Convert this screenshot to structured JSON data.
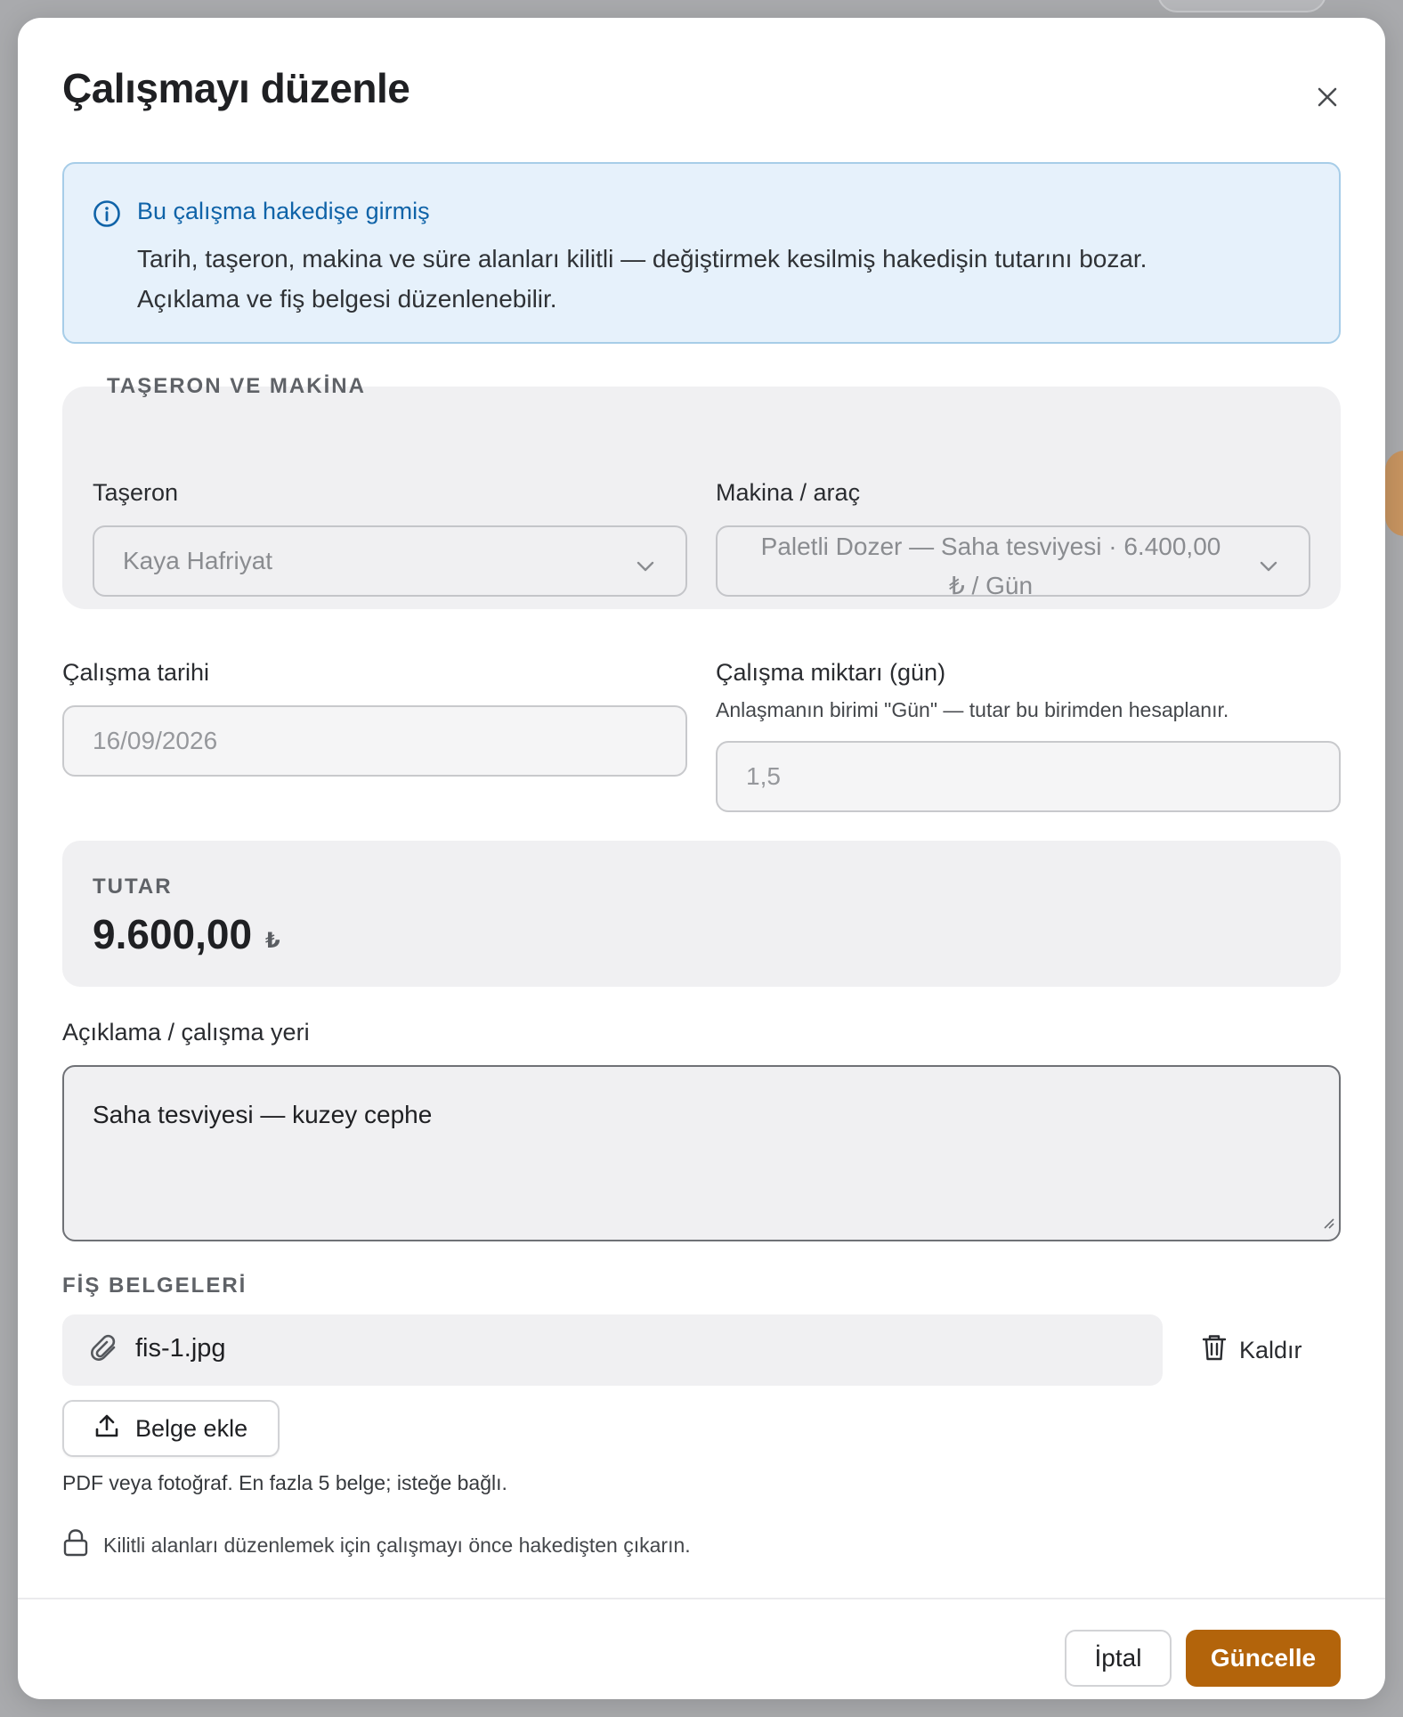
{
  "modal": {
    "title": "Çalışmayı düzenle",
    "close_icon": "close-icon"
  },
  "info": {
    "icon": "info-icon",
    "title": "Bu çalışma hakedişe girmiş",
    "line1": "Tarih, taşeron, makina ve süre alanları kilitli — değiştirmek kesilmiş hakedişin tutarını bozar.",
    "line2": "Açıklama ve fiş belgesi düzenlenebilir."
  },
  "group": {
    "legend": "TAŞERON VE MAKİNA",
    "subcontractor": {
      "label": "Taşeron",
      "value": "Kaya Hafriyat"
    },
    "machine": {
      "label": "Makina / araç",
      "value_line1": "Paletli Dozer — Saha tesviyesi · 6.400,00",
      "value_line2": "₺ / Gün"
    }
  },
  "work_date": {
    "label": "Çalışma tarihi",
    "value": "16/09/2026"
  },
  "work_amount": {
    "label": "Çalışma miktarı (gün)",
    "hint": "Anlaşmanın birimi \"Gün\" — tutar bu birimden hesaplanır.",
    "value": "1,5"
  },
  "total": {
    "label": "TUTAR",
    "value": "9.600,00",
    "currency": "₺"
  },
  "description": {
    "label": "Açıklama / çalışma yeri",
    "value": "Saha tesviyesi — kuzey cephe"
  },
  "receipts": {
    "label": "FİŞ BELGELERİ",
    "files": [
      {
        "name": "fis-1.jpg",
        "icon": "paperclip-icon"
      }
    ],
    "remove_label": "Kaldır",
    "add_label": "Belge ekle",
    "helper": "PDF veya fotoğraf. En fazla 5 belge; isteğe bağlı.",
    "lock_note": "Kilitli alanları düzenlemek için çalışmayı önce hakedişten çıkarın."
  },
  "footer": {
    "cancel_label": "İptal",
    "update_label": "Güncelle"
  },
  "colors": {
    "accent": "#b3640b",
    "info_bg": "#e6f1fb",
    "info_text": "#0f63a8"
  }
}
